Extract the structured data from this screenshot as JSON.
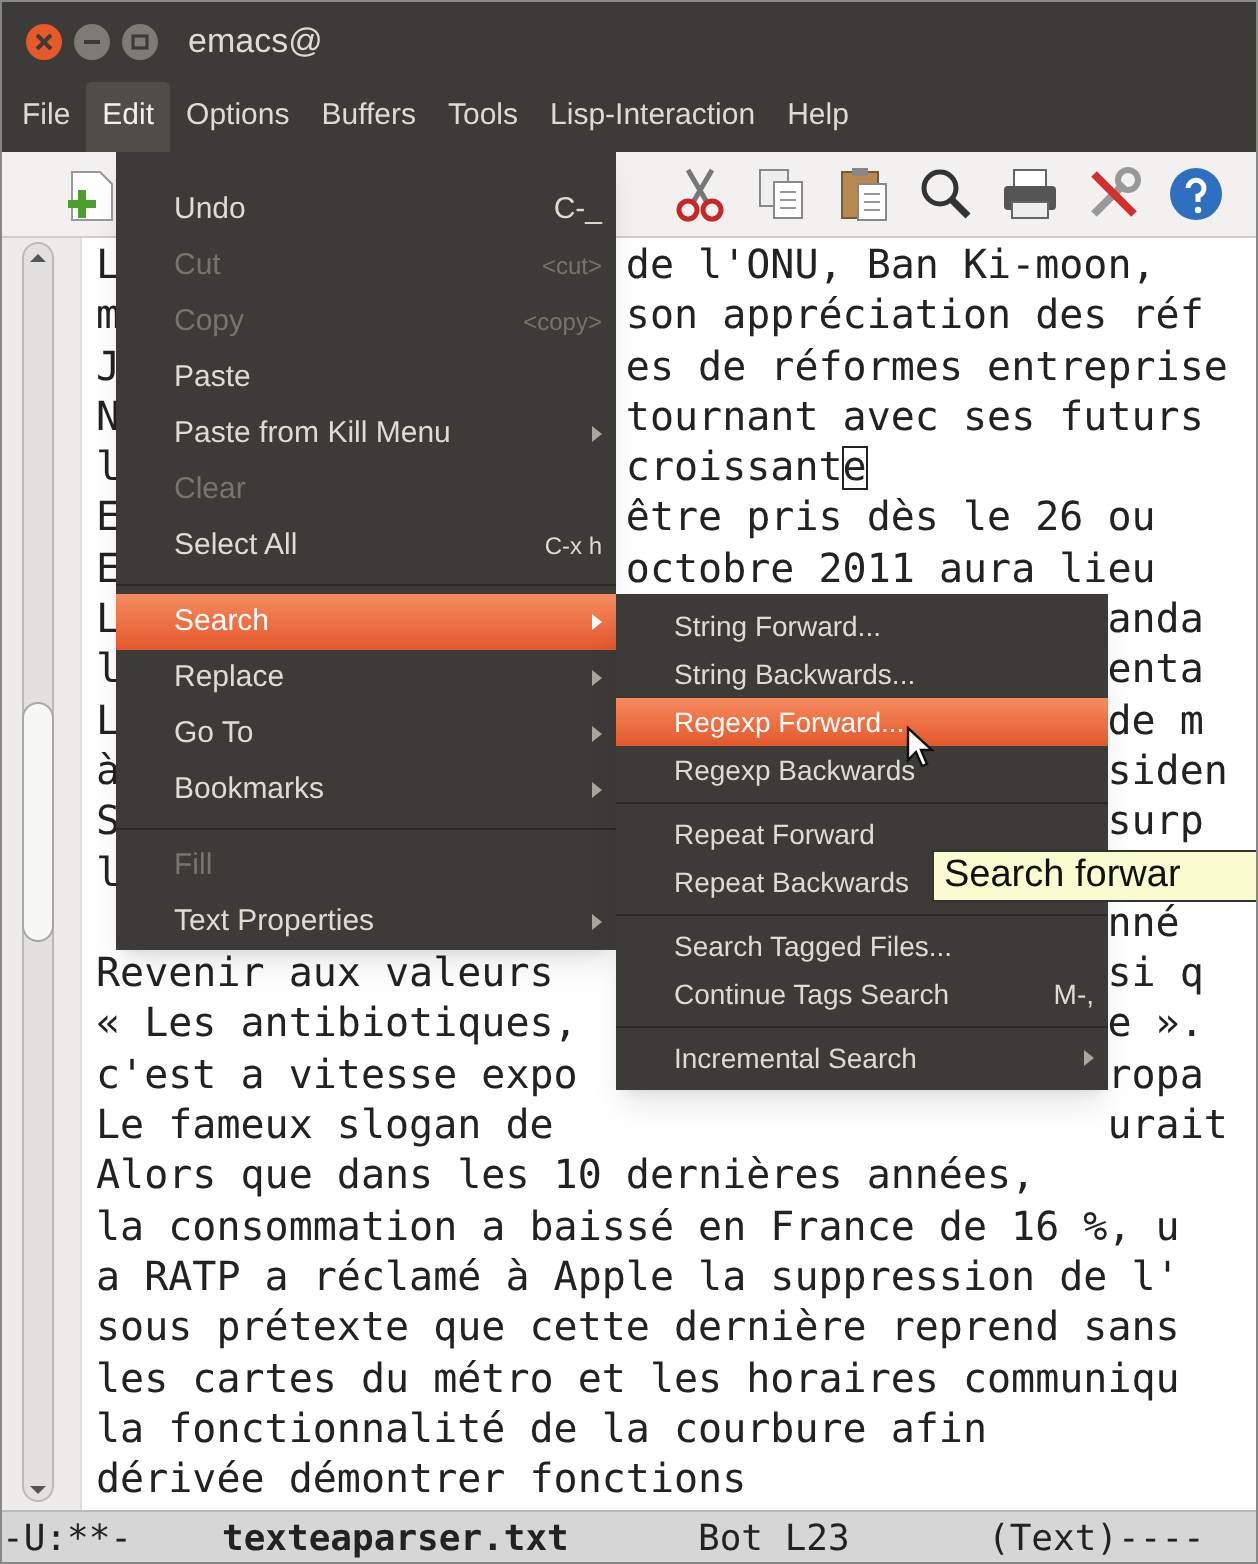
{
  "window": {
    "title": "emacs@"
  },
  "menubar": [
    {
      "label": "File",
      "selected": false
    },
    {
      "label": "Edit",
      "selected": true
    },
    {
      "label": "Options",
      "selected": false
    },
    {
      "label": "Buffers",
      "selected": false
    },
    {
      "label": "Tools",
      "selected": false
    },
    {
      "label": "Lisp-Interaction",
      "selected": false
    },
    {
      "label": "Help",
      "selected": false
    }
  ],
  "edit_menu": [
    {
      "kind": "item",
      "label": "Undo",
      "shortcut": "C-_",
      "disabled": false,
      "submenu": false,
      "selected": false
    },
    {
      "kind": "item",
      "label": "Cut",
      "shortcut": "<cut>",
      "disabled": true,
      "submenu": false,
      "selected": false
    },
    {
      "kind": "item",
      "label": "Copy",
      "shortcut": "<copy>",
      "disabled": true,
      "submenu": false,
      "selected": false
    },
    {
      "kind": "item",
      "label": "Paste",
      "disabled": false,
      "submenu": false,
      "selected": false
    },
    {
      "kind": "item",
      "label": "Paste from Kill Menu",
      "disabled": false,
      "submenu": true,
      "selected": false
    },
    {
      "kind": "item",
      "label": "Clear",
      "disabled": true,
      "submenu": false,
      "selected": false
    },
    {
      "kind": "item",
      "label": "Select All",
      "shortcut": "C-x h",
      "disabled": false,
      "submenu": false,
      "selected": false
    },
    {
      "kind": "separator"
    },
    {
      "kind": "item",
      "label": "Search",
      "disabled": false,
      "submenu": true,
      "selected": true
    },
    {
      "kind": "item",
      "label": "Replace",
      "disabled": false,
      "submenu": true,
      "selected": false
    },
    {
      "kind": "item",
      "label": "Go To",
      "disabled": false,
      "submenu": true,
      "selected": false
    },
    {
      "kind": "item",
      "label": "Bookmarks",
      "disabled": false,
      "submenu": true,
      "selected": false
    },
    {
      "kind": "separator"
    },
    {
      "kind": "item",
      "label": "Fill",
      "disabled": true,
      "submenu": false,
      "selected": false
    },
    {
      "kind": "item",
      "label": "Text Properties",
      "disabled": false,
      "submenu": true,
      "selected": false
    }
  ],
  "search_menu": [
    {
      "kind": "item",
      "label": "String Forward...",
      "disabled": false,
      "submenu": false,
      "selected": false
    },
    {
      "kind": "item",
      "label": "String Backwards...",
      "disabled": false,
      "submenu": false,
      "selected": false
    },
    {
      "kind": "item",
      "label": "Regexp Forward...",
      "disabled": false,
      "submenu": false,
      "selected": true
    },
    {
      "kind": "item",
      "label": "Regexp Backwards",
      "disabled": false,
      "submenu": false,
      "selected": false
    },
    {
      "kind": "separator"
    },
    {
      "kind": "item",
      "label": "Repeat Forward",
      "disabled": false,
      "submenu": false,
      "selected": false
    },
    {
      "kind": "item",
      "label": "Repeat Backwards",
      "disabled": false,
      "submenu": false,
      "selected": false
    },
    {
      "kind": "separator"
    },
    {
      "kind": "item",
      "label": "Search Tagged Files...",
      "disabled": false,
      "submenu": false,
      "selected": false
    },
    {
      "kind": "item",
      "label": "Continue Tags Search",
      "shortcut": "M-,",
      "disabled": false,
      "submenu": false,
      "selected": false
    },
    {
      "kind": "separator"
    },
    {
      "kind": "item",
      "label": "Incremental Search",
      "disabled": false,
      "submenu": true,
      "selected": false
    }
  ],
  "tooltip": "Search forwar",
  "buffer_lines": [
    {
      "left": "L",
      "right": "de l'ONU, Ban Ki-moon,"
    },
    {
      "left": "m",
      "right": "son appréciation des réf"
    },
    {
      "left": "J",
      "right": "es de réformes entreprise"
    },
    {
      "left": "N",
      "right": "tournant avec ses futurs"
    },
    {
      "left": "l",
      "right": "croissante",
      "cursor": true
    },
    {
      "left": "E",
      "right": "être pris dès le 26 ou"
    },
    {
      "left": "E",
      "right": "octobre 2011 aura lieu"
    },
    {
      "left": "L",
      "right": "anda"
    },
    {
      "left": "l",
      "right": "enta"
    },
    {
      "left": "L",
      "right": "de m"
    },
    {
      "left": "à",
      "right": "siden"
    },
    {
      "left": "S",
      "right": "surp"
    },
    {
      "left": "l"
    },
    {
      "right": "nné"
    },
    {
      "left": "Revenir aux valeurs",
      "right": "si q"
    },
    {
      "left": "« Les antibiotiques,",
      "right": "e »."
    },
    {
      "left": "c'est a vitesse expo",
      "right": "ropa"
    },
    {
      "left": "Le fameux slogan de",
      "right": "urait"
    },
    {
      "left": "Alors que dans les 10 dernières années,"
    },
    {
      "left": "la consommation a baissé en France de 16 %, u"
    },
    {
      "left": "a RATP a réclamé à Apple la suppression de l'"
    },
    {
      "left": "sous prétexte que cette dernière reprend sans"
    },
    {
      "left": "les cartes du métro et les horaires communiqu"
    },
    {
      "left": "la fonctionnalité de la courbure afin"
    },
    {
      "left": "dérivée démontrer fonctions"
    }
  ],
  "mode_line": {
    "status": "-U:**-",
    "buffer": "texteaparser.txt",
    "position": "Bot L23",
    "mode": "(Text)----"
  }
}
